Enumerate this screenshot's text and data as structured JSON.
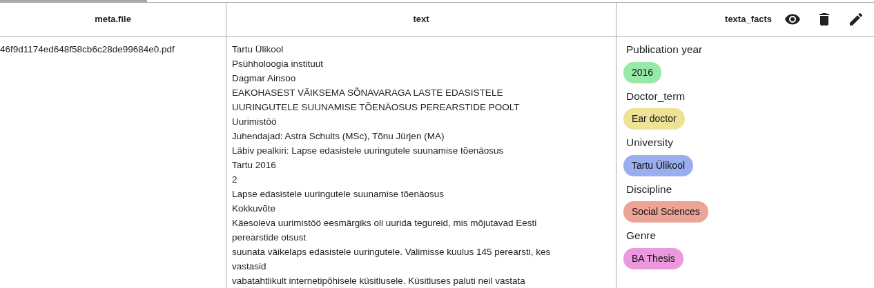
{
  "table": {
    "columns": [
      {
        "label": "meta.file"
      },
      {
        "label": "text"
      },
      {
        "label": "texta_facts"
      }
    ],
    "rows": [
      {
        "file": "46f9d1174ed648f58cb6c28de99684e0.pdf",
        "text_lines": [
          "Tartu Ülikool",
          "Psühholoogia instituut",
          "Dagmar Ainsoo",
          "EAKOHASEST VÄIKSEMA SÕNAVARAGA LASTE EDASISTELE",
          "UURINGUTELE SUUNAMISE TÕENÄOSUS PEREARSTIDE POOLT",
          "Uurimistöö",
          "Juhendajad: Astra Schults (MSc), Tõnu Jürjen (MA)",
          "Läbiv pealkiri: Lapse edasistele uuringutele suunamise tõenäosus",
          "Tartu 2016",
          "2",
          "Lapse edasistele uuringutele suunamise tõenäosus",
          "Kokkuvõte",
          "Käesoleva uurimistöö eesmärgiks oli uurida tegureid, mis mõjutavad Eesti",
          "perearstide otsust",
          "suunata väikelaps edasistele uuringutele. Valimisse kuulus 145 perearsti, kes",
          "vastasid",
          "vabatahtlikult internetipõhisele küsitlusele. Küsitluses paluti neil vastata"
        ],
        "facts": [
          {
            "name": "Publication year",
            "value": "2016",
            "color": "#98e8a8"
          },
          {
            "name": "Doctor_term",
            "value": "Ear doctor",
            "color": "#ede296"
          },
          {
            "name": "University",
            "value": "Tartu Ülikool",
            "color": "#99aeee"
          },
          {
            "name": "Discipline",
            "value": "Social Sciences",
            "color": "#eca497"
          },
          {
            "name": "Genre",
            "value": "BA Thesis",
            "color": "#ec98dc"
          }
        ]
      }
    ]
  }
}
